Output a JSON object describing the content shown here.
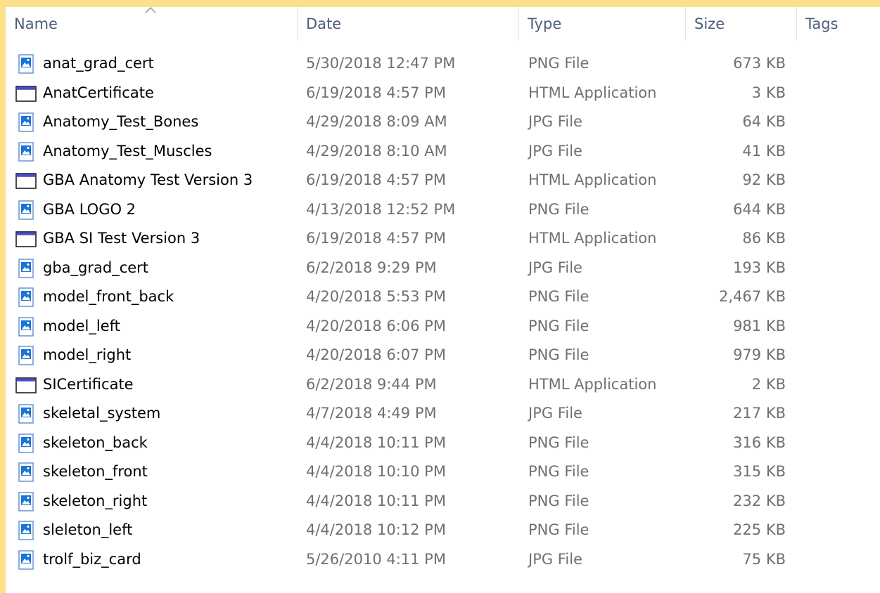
{
  "columns": {
    "name": "Name",
    "date": "Date",
    "type": "Type",
    "size": "Size",
    "tags": "Tags"
  },
  "files": [
    {
      "name": "anat_grad_cert",
      "date": "5/30/2018 12:47 PM",
      "type": "PNG File",
      "size": "673 KB",
      "icon": "image-file-icon"
    },
    {
      "name": "AnatCertificate",
      "date": "6/19/2018 4:57 PM",
      "type": "HTML Application",
      "size": "3 KB",
      "icon": "application-window-icon"
    },
    {
      "name": "Anatomy_Test_Bones",
      "date": "4/29/2018 8:09 AM",
      "type": "JPG File",
      "size": "64 KB",
      "icon": "image-file-icon"
    },
    {
      "name": "Anatomy_Test_Muscles",
      "date": "4/29/2018 8:10 AM",
      "type": "JPG File",
      "size": "41 KB",
      "icon": "image-file-icon"
    },
    {
      "name": "GBA Anatomy Test Version 3",
      "date": "6/19/2018 4:57 PM",
      "type": "HTML Application",
      "size": "92 KB",
      "icon": "application-window-icon"
    },
    {
      "name": "GBA LOGO 2",
      "date": "4/13/2018 12:52 PM",
      "type": "PNG File",
      "size": "644 KB",
      "icon": "image-file-icon"
    },
    {
      "name": "GBA SI Test Version 3",
      "date": "6/19/2018 4:57 PM",
      "type": "HTML Application",
      "size": "86 KB",
      "icon": "application-window-icon"
    },
    {
      "name": "gba_grad_cert",
      "date": "6/2/2018 9:29 PM",
      "type": "JPG File",
      "size": "193 KB",
      "icon": "image-file-icon"
    },
    {
      "name": "model_front_back",
      "date": "4/20/2018 5:53 PM",
      "type": "PNG File",
      "size": "2,467 KB",
      "icon": "image-file-icon"
    },
    {
      "name": "model_left",
      "date": "4/20/2018 6:06 PM",
      "type": "PNG File",
      "size": "981 KB",
      "icon": "image-file-icon"
    },
    {
      "name": "model_right",
      "date": "4/20/2018 6:07 PM",
      "type": "PNG File",
      "size": "979 KB",
      "icon": "image-file-icon"
    },
    {
      "name": "SICertificate",
      "date": "6/2/2018 9:44 PM",
      "type": "HTML Application",
      "size": "2 KB",
      "icon": "application-window-icon"
    },
    {
      "name": "skeletal_system",
      "date": "4/7/2018 4:49 PM",
      "type": "JPG File",
      "size": "217 KB",
      "icon": "image-file-icon"
    },
    {
      "name": "skeleton_back",
      "date": "4/4/2018 10:11 PM",
      "type": "PNG File",
      "size": "316 KB",
      "icon": "image-file-icon"
    },
    {
      "name": "skeleton_front",
      "date": "4/4/2018 10:10 PM",
      "type": "PNG File",
      "size": "315 KB",
      "icon": "image-file-icon"
    },
    {
      "name": "skeleton_right",
      "date": "4/4/2018 10:11 PM",
      "type": "PNG File",
      "size": "232 KB",
      "icon": "image-file-icon"
    },
    {
      "name": "sleleton_left",
      "date": "4/4/2018 10:12 PM",
      "type": "PNG File",
      "size": "225 KB",
      "icon": "image-file-icon"
    },
    {
      "name": "trolf_biz_card",
      "date": "5/26/2010 4:11 PM",
      "type": "JPG File",
      "size": "75 KB",
      "icon": "image-file-icon"
    }
  ],
  "colors": {
    "frame": "#fde08c",
    "header_text": "#4c607a",
    "secondary_text": "#707070",
    "icon_blue": "#1a73d6"
  }
}
